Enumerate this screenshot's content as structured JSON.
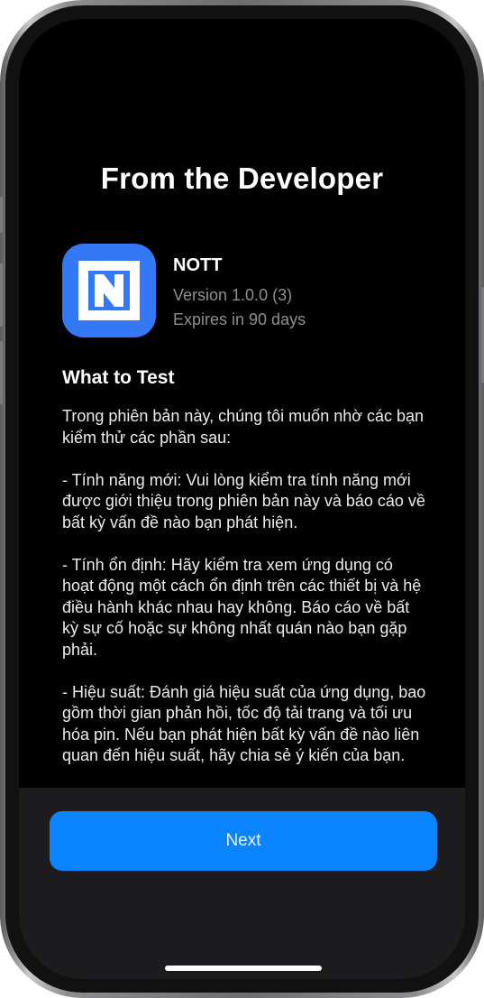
{
  "header": {
    "title": "From the Developer"
  },
  "app": {
    "name": "NOTT",
    "version": "Version 1.0.0 (3)",
    "expiry": "Expires in 90 days",
    "icon": "nott-app-icon",
    "icon_color": "#3478f6"
  },
  "notes": {
    "heading": "What to Test",
    "paragraphs": [
      "Trong phiên bản này, chúng tôi muốn nhờ các bạn kiểm thử các phần sau:",
      "- Tính năng mới: Vui lòng kiểm tra tính năng mới được giới thiệu trong phiên bản này và báo cáo về bất kỳ vấn đề nào bạn phát hiện.",
      "- Tính ổn định: Hãy kiểm tra xem ứng dụng có hoạt động một cách ổn định trên các thiết bị và hệ điều hành khác nhau hay không. Báo cáo về bất kỳ sự cố hoặc sự không nhất quán nào bạn gặp phải.",
      "- Hiệu suất: Đánh giá hiệu suất của ứng dụng, bao gồm thời gian phản hồi, tốc độ tải trang và tối ưu hóa pin. Nếu bạn phát hiện bất kỳ vấn đề nào liên quan đến hiệu suất, hãy chia sẻ ý kiến của bạn."
    ]
  },
  "footer": {
    "next_label": "Next",
    "button_color": "#0a84ff"
  }
}
